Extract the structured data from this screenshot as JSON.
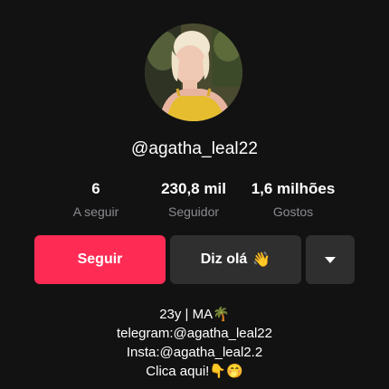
{
  "profile": {
    "username": "@agatha_leal22"
  },
  "stats": [
    {
      "value": "6",
      "label": "A seguir"
    },
    {
      "value": "230,8 mil",
      "label": "Seguidor"
    },
    {
      "value": "1,6 milhões",
      "label": "Gostos"
    }
  ],
  "actions": {
    "follow_label": "Seguir",
    "hello_label": "Diz olá",
    "hello_emoji": "👋",
    "more_icon": "chevron-down-icon"
  },
  "bio": [
    "23y | MA🌴",
    "telegram:@agatha_leal22",
    "Insta:@agatha_leal2.2",
    "Clica aqui!👇🤭"
  ],
  "colors": {
    "background": "#121212",
    "follow": "#fe2c55",
    "secondary_button": "#2f2f2f",
    "muted_text": "#8a8b91"
  }
}
